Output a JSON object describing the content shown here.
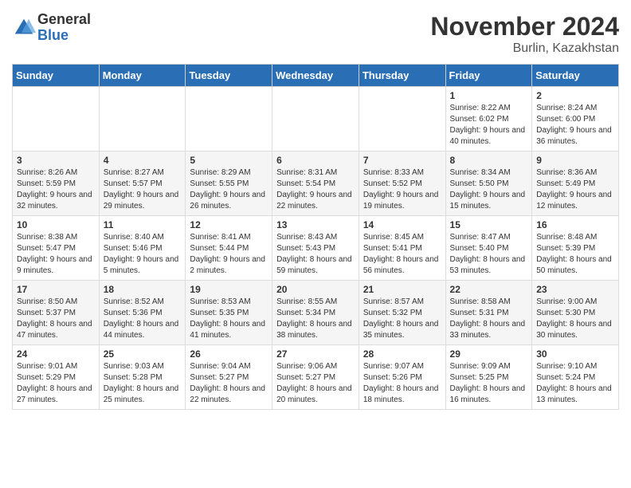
{
  "header": {
    "logo_general": "General",
    "logo_blue": "Blue",
    "month_title": "November 2024",
    "location": "Burlin, Kazakhstan"
  },
  "weekdays": [
    "Sunday",
    "Monday",
    "Tuesday",
    "Wednesday",
    "Thursday",
    "Friday",
    "Saturday"
  ],
  "weeks": [
    [
      {
        "day": "",
        "sunrise": "",
        "sunset": "",
        "daylight": ""
      },
      {
        "day": "",
        "sunrise": "",
        "sunset": "",
        "daylight": ""
      },
      {
        "day": "",
        "sunrise": "",
        "sunset": "",
        "daylight": ""
      },
      {
        "day": "",
        "sunrise": "",
        "sunset": "",
        "daylight": ""
      },
      {
        "day": "",
        "sunrise": "",
        "sunset": "",
        "daylight": ""
      },
      {
        "day": "1",
        "sunrise": "Sunrise: 8:22 AM",
        "sunset": "Sunset: 6:02 PM",
        "daylight": "Daylight: 9 hours and 40 minutes."
      },
      {
        "day": "2",
        "sunrise": "Sunrise: 8:24 AM",
        "sunset": "Sunset: 6:00 PM",
        "daylight": "Daylight: 9 hours and 36 minutes."
      }
    ],
    [
      {
        "day": "3",
        "sunrise": "Sunrise: 8:26 AM",
        "sunset": "Sunset: 5:59 PM",
        "daylight": "Daylight: 9 hours and 32 minutes."
      },
      {
        "day": "4",
        "sunrise": "Sunrise: 8:27 AM",
        "sunset": "Sunset: 5:57 PM",
        "daylight": "Daylight: 9 hours and 29 minutes."
      },
      {
        "day": "5",
        "sunrise": "Sunrise: 8:29 AM",
        "sunset": "Sunset: 5:55 PM",
        "daylight": "Daylight: 9 hours and 26 minutes."
      },
      {
        "day": "6",
        "sunrise": "Sunrise: 8:31 AM",
        "sunset": "Sunset: 5:54 PM",
        "daylight": "Daylight: 9 hours and 22 minutes."
      },
      {
        "day": "7",
        "sunrise": "Sunrise: 8:33 AM",
        "sunset": "Sunset: 5:52 PM",
        "daylight": "Daylight: 9 hours and 19 minutes."
      },
      {
        "day": "8",
        "sunrise": "Sunrise: 8:34 AM",
        "sunset": "Sunset: 5:50 PM",
        "daylight": "Daylight: 9 hours and 15 minutes."
      },
      {
        "day": "9",
        "sunrise": "Sunrise: 8:36 AM",
        "sunset": "Sunset: 5:49 PM",
        "daylight": "Daylight: 9 hours and 12 minutes."
      }
    ],
    [
      {
        "day": "10",
        "sunrise": "Sunrise: 8:38 AM",
        "sunset": "Sunset: 5:47 PM",
        "daylight": "Daylight: 9 hours and 9 minutes."
      },
      {
        "day": "11",
        "sunrise": "Sunrise: 8:40 AM",
        "sunset": "Sunset: 5:46 PM",
        "daylight": "Daylight: 9 hours and 5 minutes."
      },
      {
        "day": "12",
        "sunrise": "Sunrise: 8:41 AM",
        "sunset": "Sunset: 5:44 PM",
        "daylight": "Daylight: 9 hours and 2 minutes."
      },
      {
        "day": "13",
        "sunrise": "Sunrise: 8:43 AM",
        "sunset": "Sunset: 5:43 PM",
        "daylight": "Daylight: 8 hours and 59 minutes."
      },
      {
        "day": "14",
        "sunrise": "Sunrise: 8:45 AM",
        "sunset": "Sunset: 5:41 PM",
        "daylight": "Daylight: 8 hours and 56 minutes."
      },
      {
        "day": "15",
        "sunrise": "Sunrise: 8:47 AM",
        "sunset": "Sunset: 5:40 PM",
        "daylight": "Daylight: 8 hours and 53 minutes."
      },
      {
        "day": "16",
        "sunrise": "Sunrise: 8:48 AM",
        "sunset": "Sunset: 5:39 PM",
        "daylight": "Daylight: 8 hours and 50 minutes."
      }
    ],
    [
      {
        "day": "17",
        "sunrise": "Sunrise: 8:50 AM",
        "sunset": "Sunset: 5:37 PM",
        "daylight": "Daylight: 8 hours and 47 minutes."
      },
      {
        "day": "18",
        "sunrise": "Sunrise: 8:52 AM",
        "sunset": "Sunset: 5:36 PM",
        "daylight": "Daylight: 8 hours and 44 minutes."
      },
      {
        "day": "19",
        "sunrise": "Sunrise: 8:53 AM",
        "sunset": "Sunset: 5:35 PM",
        "daylight": "Daylight: 8 hours and 41 minutes."
      },
      {
        "day": "20",
        "sunrise": "Sunrise: 8:55 AM",
        "sunset": "Sunset: 5:34 PM",
        "daylight": "Daylight: 8 hours and 38 minutes."
      },
      {
        "day": "21",
        "sunrise": "Sunrise: 8:57 AM",
        "sunset": "Sunset: 5:32 PM",
        "daylight": "Daylight: 8 hours and 35 minutes."
      },
      {
        "day": "22",
        "sunrise": "Sunrise: 8:58 AM",
        "sunset": "Sunset: 5:31 PM",
        "daylight": "Daylight: 8 hours and 33 minutes."
      },
      {
        "day": "23",
        "sunrise": "Sunrise: 9:00 AM",
        "sunset": "Sunset: 5:30 PM",
        "daylight": "Daylight: 8 hours and 30 minutes."
      }
    ],
    [
      {
        "day": "24",
        "sunrise": "Sunrise: 9:01 AM",
        "sunset": "Sunset: 5:29 PM",
        "daylight": "Daylight: 8 hours and 27 minutes."
      },
      {
        "day": "25",
        "sunrise": "Sunrise: 9:03 AM",
        "sunset": "Sunset: 5:28 PM",
        "daylight": "Daylight: 8 hours and 25 minutes."
      },
      {
        "day": "26",
        "sunrise": "Sunrise: 9:04 AM",
        "sunset": "Sunset: 5:27 PM",
        "daylight": "Daylight: 8 hours and 22 minutes."
      },
      {
        "day": "27",
        "sunrise": "Sunrise: 9:06 AM",
        "sunset": "Sunset: 5:27 PM",
        "daylight": "Daylight: 8 hours and 20 minutes."
      },
      {
        "day": "28",
        "sunrise": "Sunrise: 9:07 AM",
        "sunset": "Sunset: 5:26 PM",
        "daylight": "Daylight: 8 hours and 18 minutes."
      },
      {
        "day": "29",
        "sunrise": "Sunrise: 9:09 AM",
        "sunset": "Sunset: 5:25 PM",
        "daylight": "Daylight: 8 hours and 16 minutes."
      },
      {
        "day": "30",
        "sunrise": "Sunrise: 9:10 AM",
        "sunset": "Sunset: 5:24 PM",
        "daylight": "Daylight: 8 hours and 13 minutes."
      }
    ]
  ]
}
